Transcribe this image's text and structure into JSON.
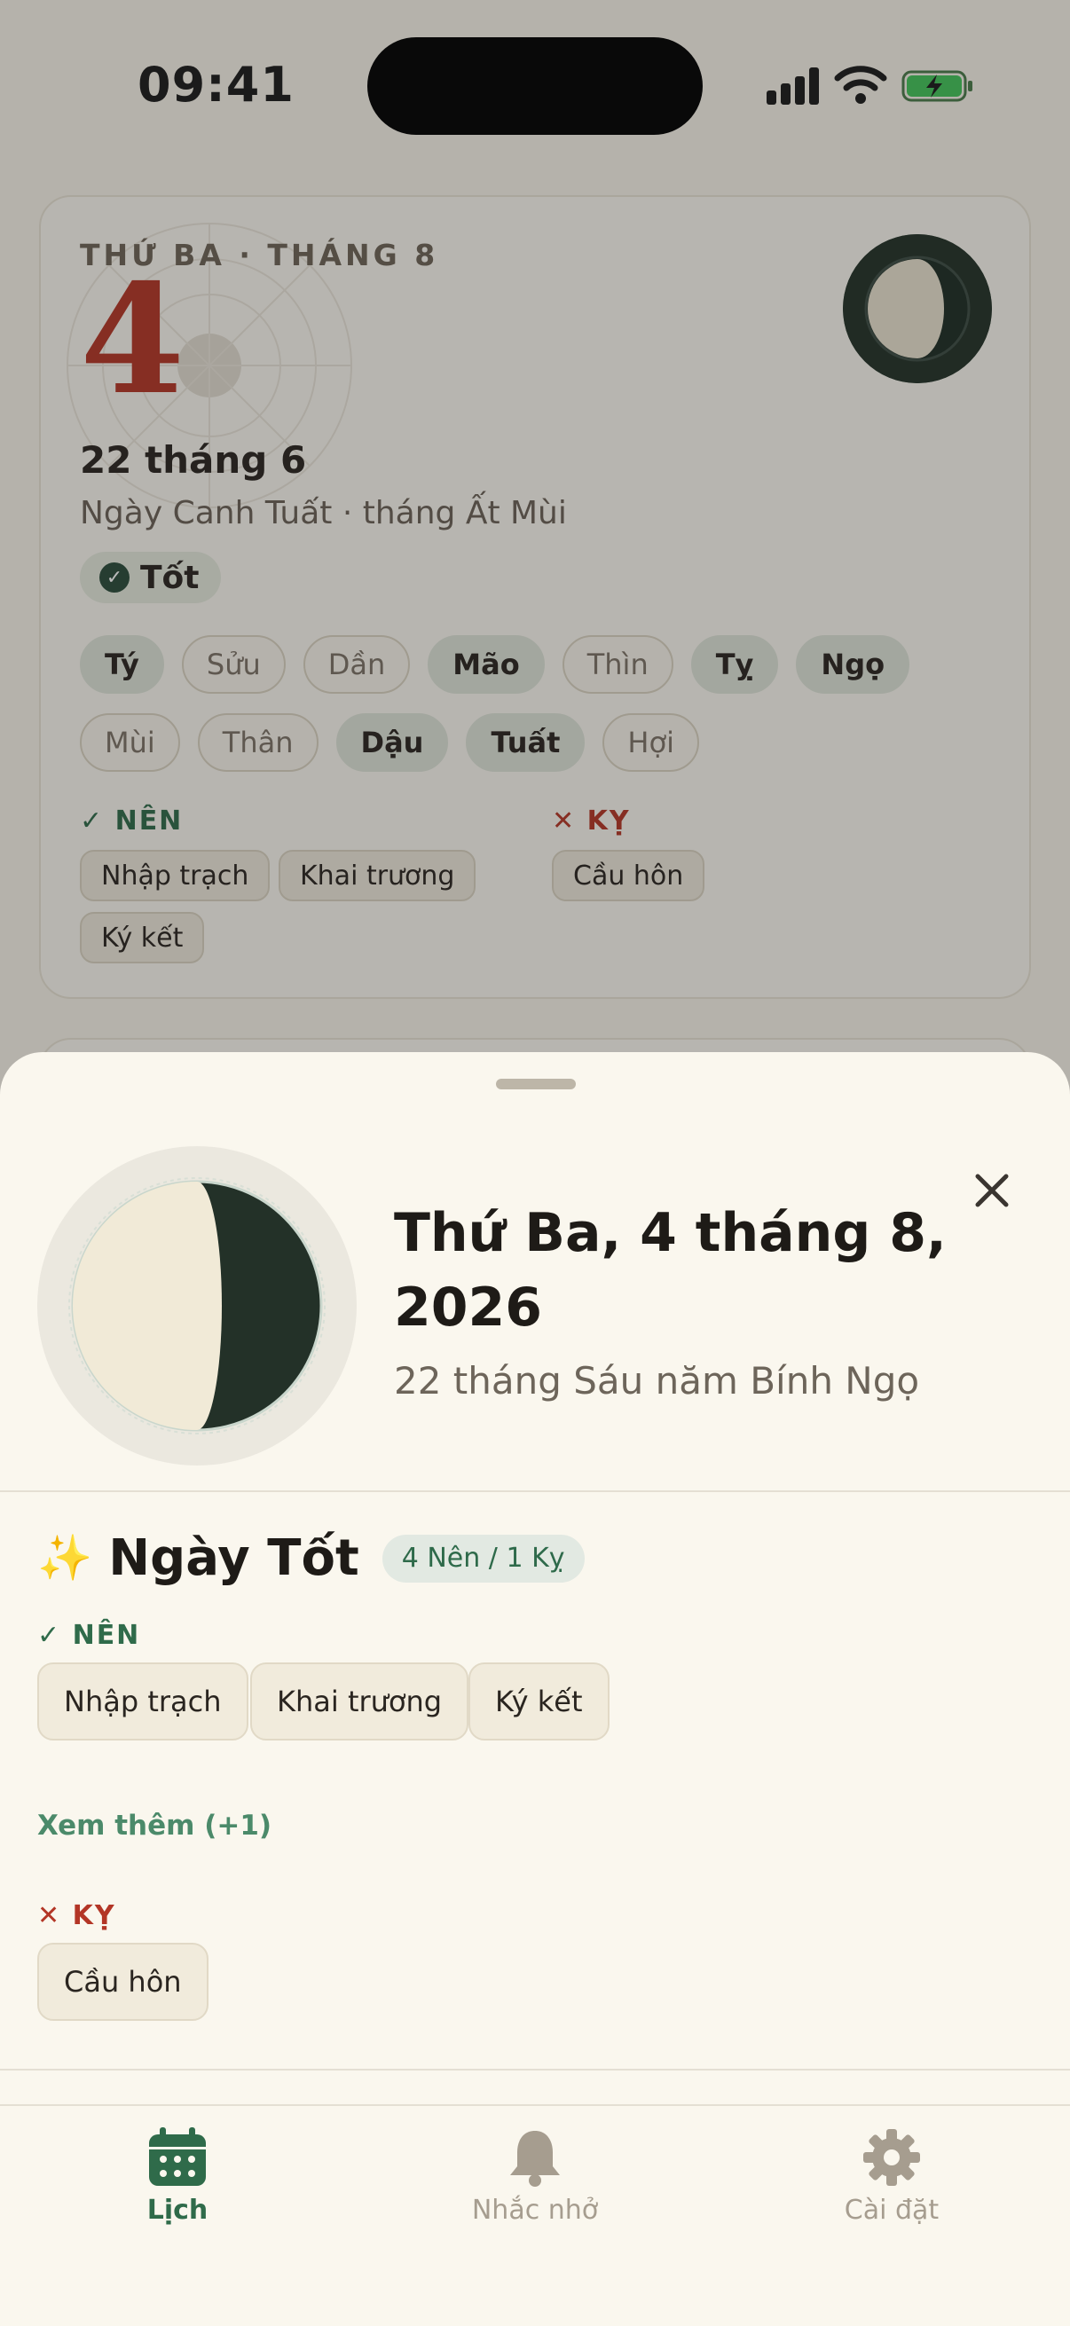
{
  "status_bar": {
    "time": "09:41"
  },
  "card": {
    "weekday_month": "THỨ BA · THÁNG 8",
    "day": "4",
    "lunar_date": "22 tháng 6",
    "can_chi": "Ngày Canh Tuất · tháng Ất Mùi",
    "rating": "Tốt",
    "hours": [
      {
        "label": "Tý",
        "good": true
      },
      {
        "label": "Sửu",
        "good": false
      },
      {
        "label": "Dần",
        "good": false
      },
      {
        "label": "Mão",
        "good": true
      },
      {
        "label": "Thìn",
        "good": false
      },
      {
        "label": "Tỵ",
        "good": true
      },
      {
        "label": "Ngọ",
        "good": true
      },
      {
        "label": "Mùi",
        "good": false
      },
      {
        "label": "Thân",
        "good": false
      },
      {
        "label": "Dậu",
        "good": true
      },
      {
        "label": "Tuất",
        "good": true
      },
      {
        "label": "Hợi",
        "good": false
      }
    ],
    "nen_label": "✓ NÊN",
    "ky_label": "✕ KỴ",
    "nen": [
      "Nhập trạch",
      "Khai trương",
      "Ký kết"
    ],
    "ky": [
      "Cầu hôn"
    ]
  },
  "sheet": {
    "title": "Thứ Ba, 4 tháng 8, 2026",
    "subtitle": "22 tháng Sáu năm Bính Ngọ",
    "rating_title": "Ngày Tốt",
    "rating_badge": "4 Nên / 1 Kỵ",
    "nen_label": "✓ NÊN",
    "nen": [
      "Nhập trạch",
      "Khai trương",
      "Ký kết"
    ],
    "more_link": "Xem thêm (+1)",
    "ky_label": "✕ KỴ",
    "ky": [
      "Cầu hôn"
    ]
  },
  "tabs": [
    {
      "label": "Lịch",
      "icon": "calendar-icon",
      "active": true
    },
    {
      "label": "Nhắc nhở",
      "icon": "bell-icon",
      "active": false
    },
    {
      "label": "Cài đặt",
      "icon": "gear-icon",
      "active": false
    }
  ],
  "colors": {
    "accent": "#2f6b4a",
    "danger": "#b33626",
    "moon_dark": "#233128",
    "moon_light": "#f1ead7"
  }
}
